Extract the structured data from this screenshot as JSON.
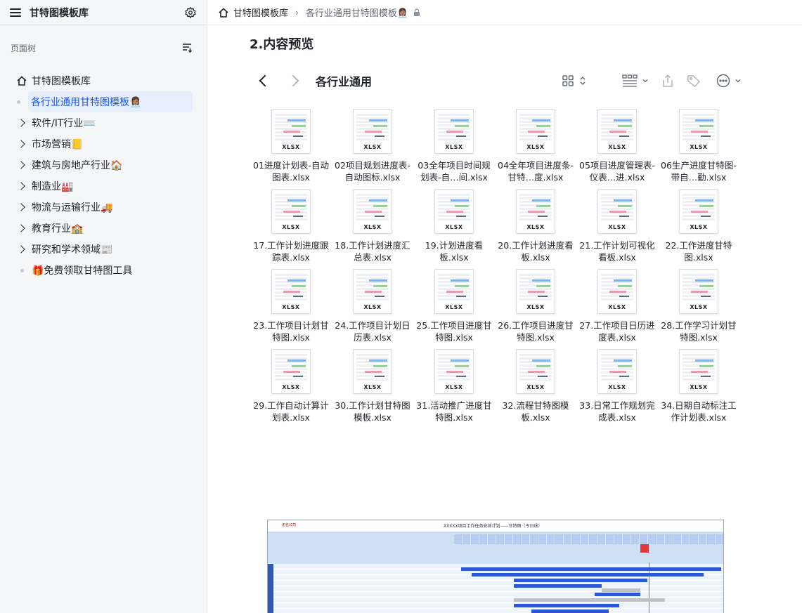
{
  "sidebar": {
    "title": "甘特图模板库",
    "tree_label": "页面树",
    "items": [
      {
        "label": "甘特图模板库",
        "kind": "root"
      },
      {
        "label": "各行业通用甘特图模板👩🏽‍💼",
        "kind": "active"
      },
      {
        "label": "软件/IT行业⌨️",
        "kind": "folder"
      },
      {
        "label": "市场营销📒",
        "kind": "folder"
      },
      {
        "label": "建筑与房地产行业🏠",
        "kind": "folder"
      },
      {
        "label": "制造业🏭",
        "kind": "folder"
      },
      {
        "label": "物流与运输行业🚚",
        "kind": "folder"
      },
      {
        "label": "教育行业🏫",
        "kind": "folder"
      },
      {
        "label": "研究和学术领域📰",
        "kind": "folder"
      },
      {
        "label": "🎁免费领取甘特图工具",
        "kind": "leaf"
      }
    ]
  },
  "breadcrumb": {
    "root": "甘特图模板库",
    "separator": "›",
    "current": "各行业通用甘特图模板👩🏽‍💼"
  },
  "main": {
    "heading": "2.内容预览",
    "folder_title": "各行业通用",
    "files": [
      "01进度计划表-自动图表.xlsx",
      "02项目规划进度表-自动图标.xlsx",
      "03全年项目时间规划表-自…间.xlsx",
      "04全年项目进度条-甘特…度.xlsx",
      "05项目进度管理表-仪表…进.xlsx",
      "06生产进度甘特图-带自…勤.xlsx",
      "17.工作计划进度跟踪表.xlsx",
      "18.工作计划进度汇总表.xlsx",
      "19.计划进度看板.xlsx",
      "20.工作计划进度看板.xlsx",
      "21.工作计划可视化看板.xlsx",
      "22.工作进度甘特图.xlsx",
      "23.工作项目计划甘特图.xlsx",
      "24.工作项目计划日历表.xlsx",
      "25.工作项目进度甘特图.xlsx",
      "26.工作项目进度甘特图.xlsx",
      "27.工作项目日历进度表.xlsx",
      "28.工作学习计划甘特图.xlsx",
      "29.工作自动计算计划表.xlsx",
      "30.工作计划甘特图模板.xlsx",
      "31.活动推广进度甘特图.xlsx",
      "32.流程甘特图模板.xlsx",
      "33.日常工作规划完成表.xlsx",
      "34.日期自动标注工作计划表.xlsx"
    ],
    "file_ext": "XLSX"
  },
  "preview": {
    "title": "XXXXX项目工作任务安排计划——甘特图（今日线）",
    "corner_text": "无名公司"
  },
  "colors": {
    "accent": "#1456f0",
    "active_bg": "#e6eefc",
    "gantt_bar": "#2b57d6"
  }
}
